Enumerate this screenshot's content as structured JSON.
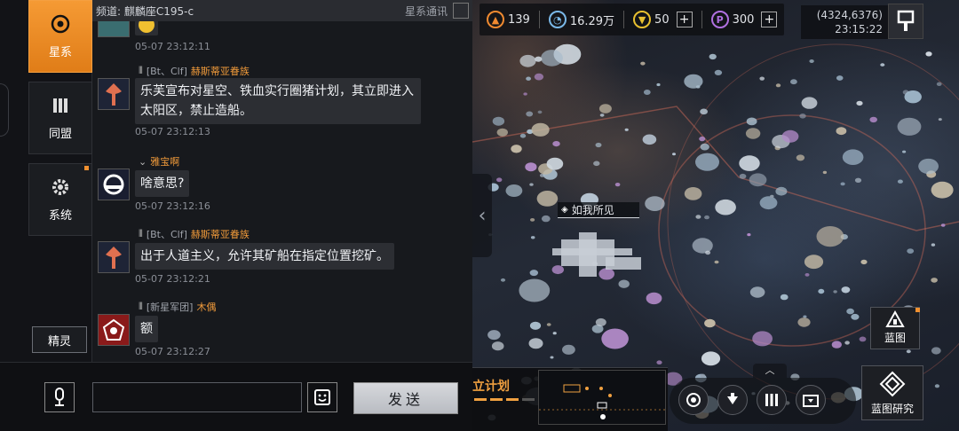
{
  "chat": {
    "nav": [
      {
        "label": "星系",
        "icon": "galaxy-icon",
        "active": true
      },
      {
        "label": "同盟",
        "icon": "alliance-icon",
        "active": false
      },
      {
        "label": "系统",
        "icon": "system-gear-icon",
        "active": false
      }
    ],
    "sprite_label": "精灵",
    "channel_title": "频道: 麒麟座C195-c",
    "channel_right": "星系通讯",
    "messages": [
      {
        "tag": "",
        "name": "",
        "text": "",
        "time": "05-07 23:12:11"
      },
      {
        "tag": "[Bt、Clf]",
        "name": "赫斯蒂亚眷族",
        "text": "乐芙宣布对星空、铁血实行圈猪计划，其立即进入太阳区，禁止造船。",
        "time": "05-07 23:12:13"
      },
      {
        "tag": "",
        "name": "雅宝啊",
        "text": "啥意思?",
        "time": "05-07 23:12:16"
      },
      {
        "tag": "[Bt、Clf]",
        "name": "赫斯蒂亚眷族",
        "text": "出于人道主义，允许其矿船在指定位置挖矿。",
        "time": "05-07 23:12:21"
      },
      {
        "tag": "[新星军团]",
        "name": "木偶",
        "text": "额",
        "time": "05-07 23:12:27"
      }
    ],
    "input_placeholder": "",
    "send_label": "发送"
  },
  "hud": {
    "resources": [
      {
        "icon": "fuel-icon",
        "value": "139"
      },
      {
        "icon": "metal-icon",
        "value": "16.29万"
      },
      {
        "icon": "gold-icon",
        "value": "50"
      },
      {
        "icon": "crystal-icon",
        "value": "300"
      }
    ],
    "coords": "(4324,6376)",
    "clock": "23:15:22",
    "ship_label": "如我所见",
    "plan_title": "立计划",
    "blueprint_label": "蓝图",
    "blueprint_research_label": "蓝图研究",
    "up_arrow": "︿"
  },
  "colors": {
    "accent": "#f0a040",
    "bubble": "#2c2e33",
    "name": "#f09a3a"
  }
}
